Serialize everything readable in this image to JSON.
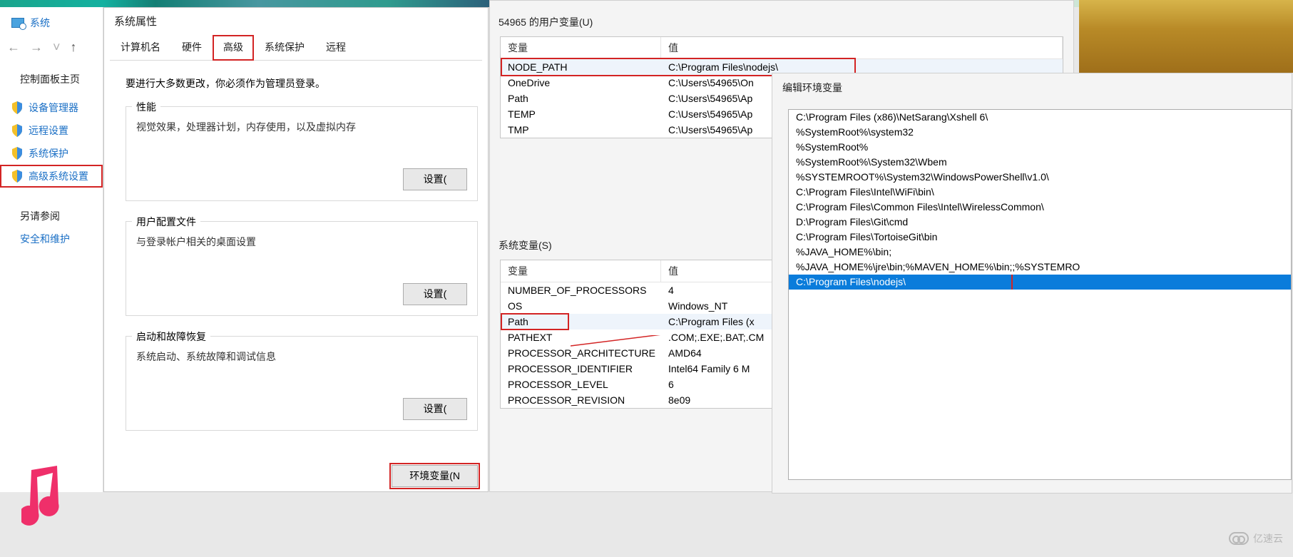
{
  "cpl": {
    "title": "系统",
    "home": "控制面板主页",
    "items": [
      {
        "label": "设备管理器"
      },
      {
        "label": "远程设置"
      },
      {
        "label": "系统保护"
      },
      {
        "label": "高级系统设置"
      }
    ],
    "see_also": "另请参阅",
    "link1": "安全和维护"
  },
  "sysprops": {
    "title": "系统属性",
    "tabs": {
      "t0": "计算机名",
      "t1": "硬件",
      "t2": "高级",
      "t3": "系统保护",
      "t4": "远程"
    },
    "admin_note": "要进行大多数更改，你必须作为管理员登录。",
    "perf": {
      "title": "性能",
      "desc": "视觉效果，处理器计划，内存使用，以及虚拟内存",
      "btn": "设置("
    },
    "profile": {
      "title": "用户配置文件",
      "desc": "与登录帐户相关的桌面设置",
      "btn": "设置("
    },
    "startup": {
      "title": "启动和故障恢复",
      "desc": "系统启动、系统故障和调试信息",
      "btn": "设置("
    },
    "envbtn": "环境变量(N"
  },
  "envvars": {
    "user_section": "54965 的用户变量(U)",
    "col_var": "变量",
    "col_val": "值",
    "user_rows": [
      {
        "k": "NODE_PATH",
        "v": "C:\\Program Files\\nodejs\\"
      },
      {
        "k": "OneDrive",
        "v": "C:\\Users\\54965\\On"
      },
      {
        "k": "Path",
        "v": "C:\\Users\\54965\\Ap"
      },
      {
        "k": "TEMP",
        "v": "C:\\Users\\54965\\Ap"
      },
      {
        "k": "TMP",
        "v": "C:\\Users\\54965\\Ap"
      }
    ],
    "sys_section": "系统变量(S)",
    "sys_rows": [
      {
        "k": "NUMBER_OF_PROCESSORS",
        "v": "4"
      },
      {
        "k": "OS",
        "v": "Windows_NT"
      },
      {
        "k": "Path",
        "v": "C:\\Program Files (x"
      },
      {
        "k": "PATHEXT",
        "v": ".COM;.EXE;.BAT;.CM"
      },
      {
        "k": "PROCESSOR_ARCHITECTURE",
        "v": "AMD64"
      },
      {
        "k": "PROCESSOR_IDENTIFIER",
        "v": "Intel64 Family 6 M"
      },
      {
        "k": "PROCESSOR_LEVEL",
        "v": "6"
      },
      {
        "k": "PROCESSOR_REVISION",
        "v": "8e09"
      }
    ]
  },
  "editenv": {
    "title": "编辑环境变量",
    "rows": [
      "C:\\Program Files (x86)\\NetSarang\\Xshell 6\\",
      "%SystemRoot%\\system32",
      "%SystemRoot%",
      "%SystemRoot%\\System32\\Wbem",
      "%SYSTEMROOT%\\System32\\WindowsPowerShell\\v1.0\\",
      "C:\\Program Files\\Intel\\WiFi\\bin\\",
      "C:\\Program Files\\Common Files\\Intel\\WirelessCommon\\",
      "D:\\Program Files\\Git\\cmd",
      "C:\\Program Files\\TortoiseGit\\bin",
      "%JAVA_HOME%\\bin;",
      "%JAVA_HOME%\\jre\\bin;%MAVEN_HOME%\\bin;;%SYSTEMRO",
      "C:\\Program Files\\nodejs\\"
    ]
  },
  "watermark": "亿速云"
}
